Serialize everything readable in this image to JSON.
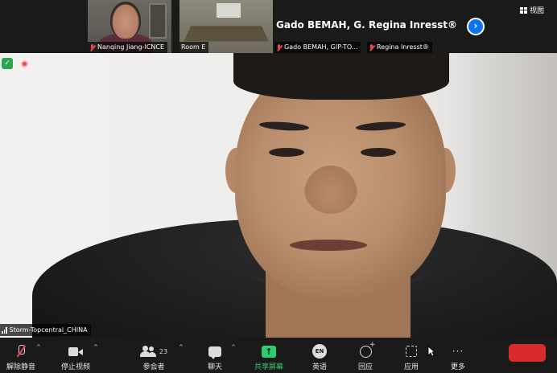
{
  "top_strip": {
    "thumbnails": [
      {
        "name": "Nanqing Jiang-ICNCE"
      },
      {
        "name": "Room E"
      },
      {
        "big_label": "Gado BEMAH, G...",
        "name": "Gado BEMAH, GIP-TO..."
      },
      {
        "big_label": "Regina Inresst® ⬚",
        "name": "Regina Inresst®"
      }
    ],
    "next_icon": "›",
    "view_label": "视图"
  },
  "main_video": {
    "speaker_name": "Storm-Topcentral_CHINA",
    "security_icon": "✓"
  },
  "toolbar": {
    "items": [
      {
        "key": "mute",
        "label": "解除静音",
        "icon": "mic-muted-icon"
      },
      {
        "key": "video",
        "label": "停止视频",
        "icon": "camera-icon"
      },
      {
        "key": "participants",
        "label": "参会者",
        "count": "23",
        "icon": "participants-icon"
      },
      {
        "key": "chat",
        "label": "聊天",
        "icon": "chat-icon"
      },
      {
        "key": "share",
        "label": "共享屏幕",
        "icon": "share-screen-icon"
      },
      {
        "key": "interpretation",
        "label": "英语",
        "icon_text": "EN"
      },
      {
        "key": "reactions",
        "label": "回应",
        "icon": "reaction-icon"
      },
      {
        "key": "apps",
        "label": "应用",
        "icon": "apps-icon"
      },
      {
        "key": "more",
        "label": "更多",
        "icon_text": "···"
      }
    ],
    "caret": "^",
    "share_arrow": "↑"
  },
  "colors": {
    "accent_blue": "#0e72ed",
    "share_green": "#2ecc71",
    "end_red": "#d92b2b",
    "muted_red": "#e5484d"
  }
}
